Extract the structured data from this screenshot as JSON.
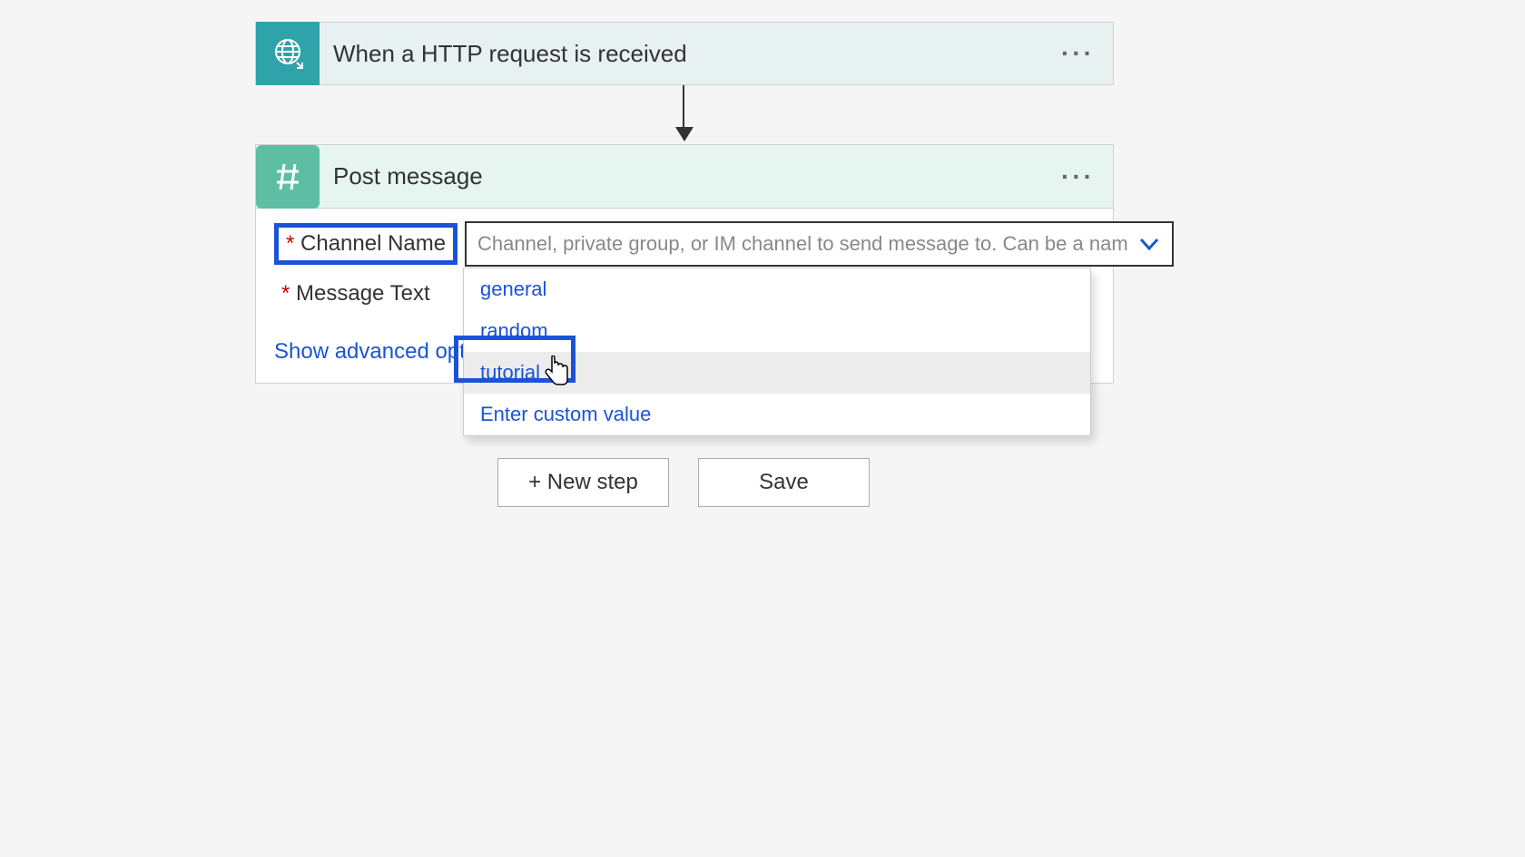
{
  "trigger": {
    "title": "When a HTTP request is received"
  },
  "action": {
    "title": "Post message",
    "fields": {
      "channel_name": {
        "label": "Channel Name",
        "placeholder": "Channel, private group, or IM channel to send message to. Can be a nam"
      },
      "message_text": {
        "label": "Message Text"
      }
    },
    "advanced_link": "Show advanced options",
    "dropdown": {
      "options": {
        "0": "general",
        "1": "random",
        "2": "tutorial",
        "3": "Enter custom value"
      }
    }
  },
  "footer": {
    "new_step": "+ New step",
    "save": "Save"
  }
}
